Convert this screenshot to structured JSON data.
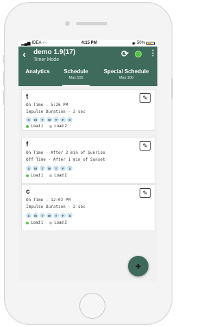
{
  "status_bar": {
    "carrier": "IDEA",
    "time": "4:15 PM",
    "battery": "50%"
  },
  "header": {
    "title": "demo 1.9(17)",
    "mode": "Timer Mode",
    "status_color": "#55c43f"
  },
  "tabs": [
    {
      "label": "Analytics",
      "sub": ""
    },
    {
      "label": "Schedule",
      "sub": "Max:100"
    },
    {
      "label": "Special Schedule",
      "sub": "Max:100"
    }
  ],
  "days": [
    "S",
    "M",
    "T",
    "W",
    "T",
    "F",
    "S"
  ],
  "schedules": [
    {
      "name": "t",
      "lines": [
        "On Time - 5:26 PM",
        "Impulse Duration - 3 sec"
      ],
      "load1": "Load 1",
      "load2": "Load 2"
    },
    {
      "name": "f",
      "lines": [
        "On Time - After 2 min of Sunrise",
        "Off Time - After 1 min of Sunset"
      ],
      "load1": "Load 1",
      "load2": "Load 2"
    },
    {
      "name": "c",
      "lines": [
        "On Time - 12:02 PM",
        "Impulse Duration - 2 sec"
      ],
      "load1": "Load 1",
      "load2": "Load 2"
    }
  ],
  "colors": {
    "app_bar": "#3f6b5c",
    "load_on": "#55c43f",
    "load_off": "#bdbdbd"
  },
  "fab": {
    "label": "+"
  }
}
